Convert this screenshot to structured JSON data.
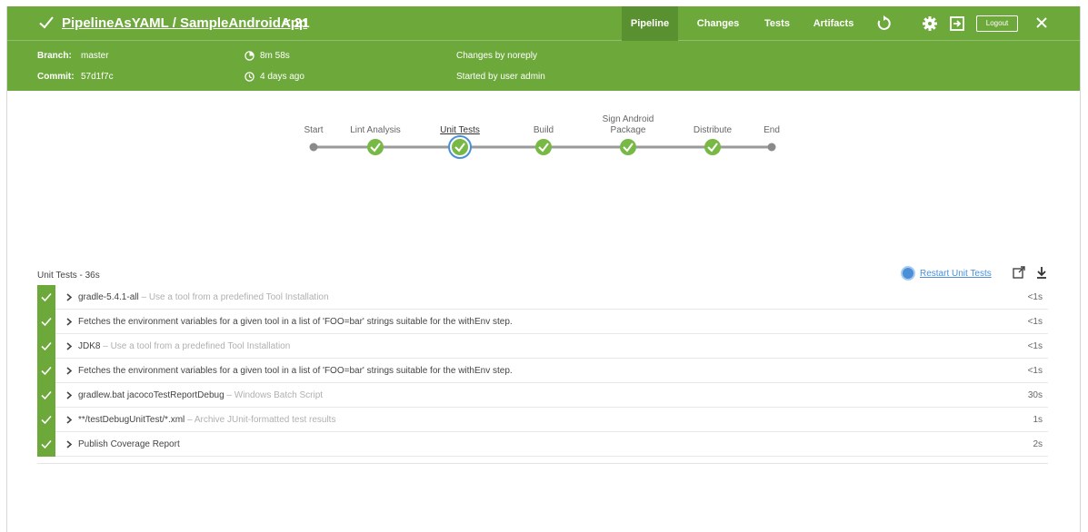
{
  "header": {
    "title": "PipelineAsYAML / SampleAndroidApp",
    "run": "< 21",
    "nav": [
      "Pipeline",
      "Changes",
      "Tests",
      "Artifacts"
    ],
    "active_nav": "Pipeline",
    "logout_label": "Logout",
    "branch_label": "Branch:",
    "branch_value": "master",
    "commit_label": "Commit:",
    "commit_value": "57d1f7c",
    "duration": "8m 58s",
    "time_ago": "4 days ago",
    "changes": "Changes by noreply",
    "started": "Started by user admin",
    "accent_color": "#6da83b"
  },
  "pipeline": {
    "stages": [
      "Start",
      "Lint Analysis",
      "Unit Tests",
      "Build",
      "Sign Android Package",
      "Distribute",
      "End"
    ],
    "selected": "Unit Tests"
  },
  "section": {
    "title": "Unit Tests - 36s",
    "restart_label": "Restart Unit Tests"
  },
  "steps": [
    {
      "title": "gradle-5.4.1-all",
      "desc": "– Use a tool from a predefined Tool Installation",
      "time": "<1s"
    },
    {
      "title": "Fetches the environment variables for a given tool in a list of 'FOO=bar' strings suitable for the withEnv step.",
      "desc": "",
      "time": "<1s"
    },
    {
      "title": "JDK8",
      "desc": "– Use a tool from a predefined Tool Installation",
      "time": "<1s"
    },
    {
      "title": "Fetches the environment variables for a given tool in a list of 'FOO=bar' strings suitable for the withEnv step.",
      "desc": "",
      "time": "<1s"
    },
    {
      "title": "gradlew.bat jacocoTestReportDebug",
      "desc": "– Windows Batch Script",
      "time": "30s"
    },
    {
      "title": "**/testDebugUnitTest/*.xml",
      "desc": "– Archive JUnit-formatted test results",
      "time": "1s"
    },
    {
      "title": "Publish Coverage Report",
      "desc": "",
      "time": "2s"
    }
  ]
}
